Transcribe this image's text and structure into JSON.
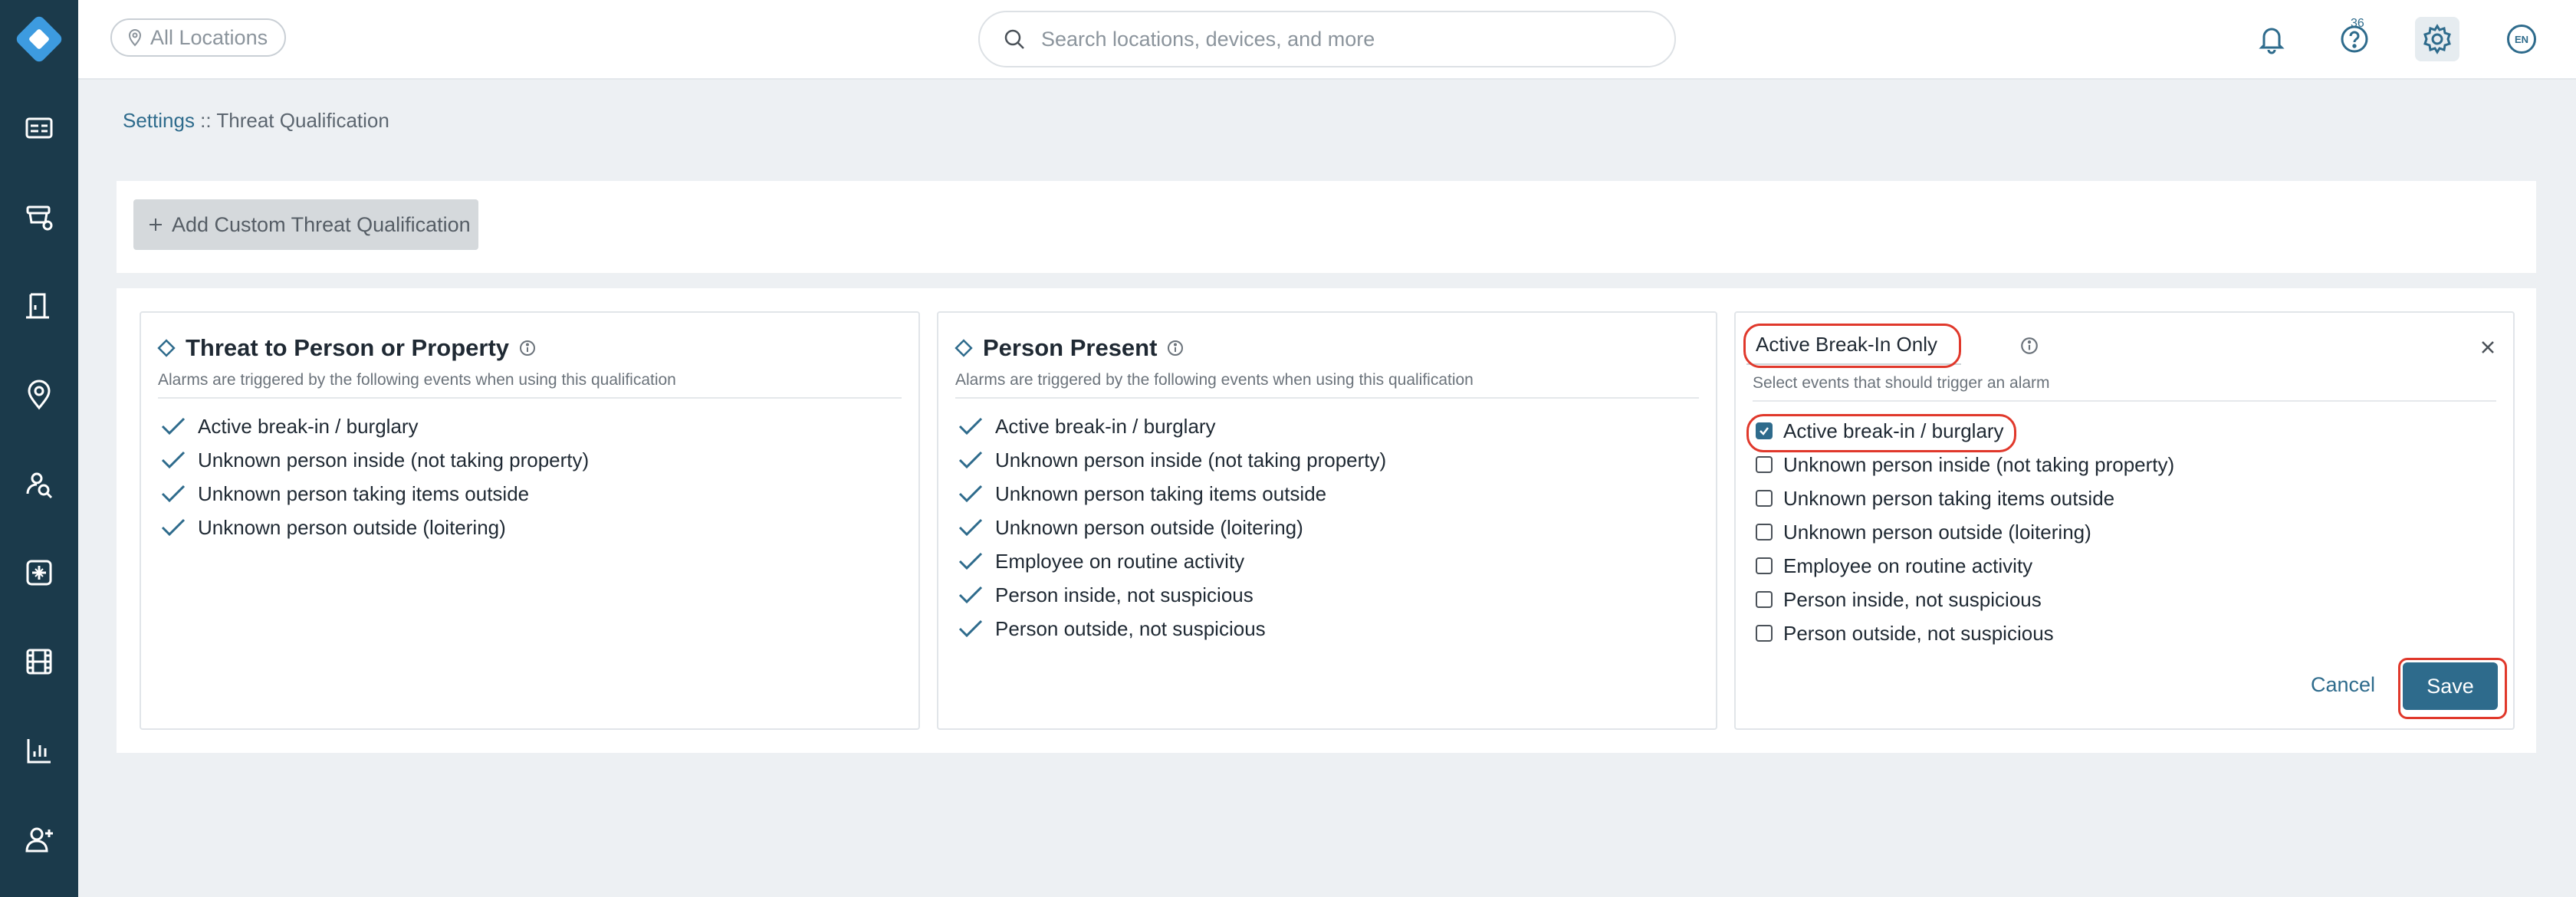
{
  "colors": {
    "sidebar": "#1b3a4b",
    "accent": "#2e6b8c",
    "highlight_ring": "#e0382b",
    "page_bg": "#edf0f3"
  },
  "sidebar": {
    "logo": "diamond-logo",
    "items": [
      {
        "icon": "dashboard-icon"
      },
      {
        "icon": "devices-icon"
      },
      {
        "icon": "access-door-icon"
      },
      {
        "icon": "location-pin-icon"
      },
      {
        "icon": "investigate-icon"
      },
      {
        "icon": "incidents-icon"
      },
      {
        "icon": "video-film-icon"
      },
      {
        "icon": "reports-chart-icon"
      },
      {
        "icon": "add-user-icon"
      }
    ]
  },
  "header": {
    "location_filter": "All Locations",
    "search_placeholder": "Search locations, devices, and more",
    "notification_count": "36",
    "language": "EN"
  },
  "breadcrumb": {
    "root": "Settings",
    "separator": " :: ",
    "current": "Threat Qualification"
  },
  "add_button_label": "Add Custom Threat Qualification",
  "cards": [
    {
      "title": "Threat to Person or Property",
      "subtitle": "Alarms are triggered by the following events when using this qualification",
      "items": [
        "Active break-in / burglary",
        "Unknown person inside (not taking property)",
        "Unknown person taking items outside",
        "Unknown person outside (loitering)"
      ]
    },
    {
      "title": "Person Present",
      "subtitle": "Alarms are triggered by the following events when using this qualification",
      "items": [
        "Active break-in / burglary",
        "Unknown person inside (not taking property)",
        "Unknown person taking items outside",
        "Unknown person outside (loitering)",
        "Employee on routine activity",
        "Person inside, not suspicious",
        "Person outside, not suspicious"
      ]
    }
  ],
  "editor": {
    "name_value": "Active Break-In Only",
    "subtitle": "Select events that should trigger an alarm",
    "options": [
      {
        "label": "Active break-in / burglary",
        "checked": true
      },
      {
        "label": "Unknown person inside (not taking property)",
        "checked": false
      },
      {
        "label": "Unknown person taking items outside",
        "checked": false
      },
      {
        "label": "Unknown person outside (loitering)",
        "checked": false
      },
      {
        "label": "Employee on routine activity",
        "checked": false
      },
      {
        "label": "Person inside, not suspicious",
        "checked": false
      },
      {
        "label": "Person outside, not suspicious",
        "checked": false
      }
    ],
    "cancel_label": "Cancel",
    "save_label": "Save"
  }
}
